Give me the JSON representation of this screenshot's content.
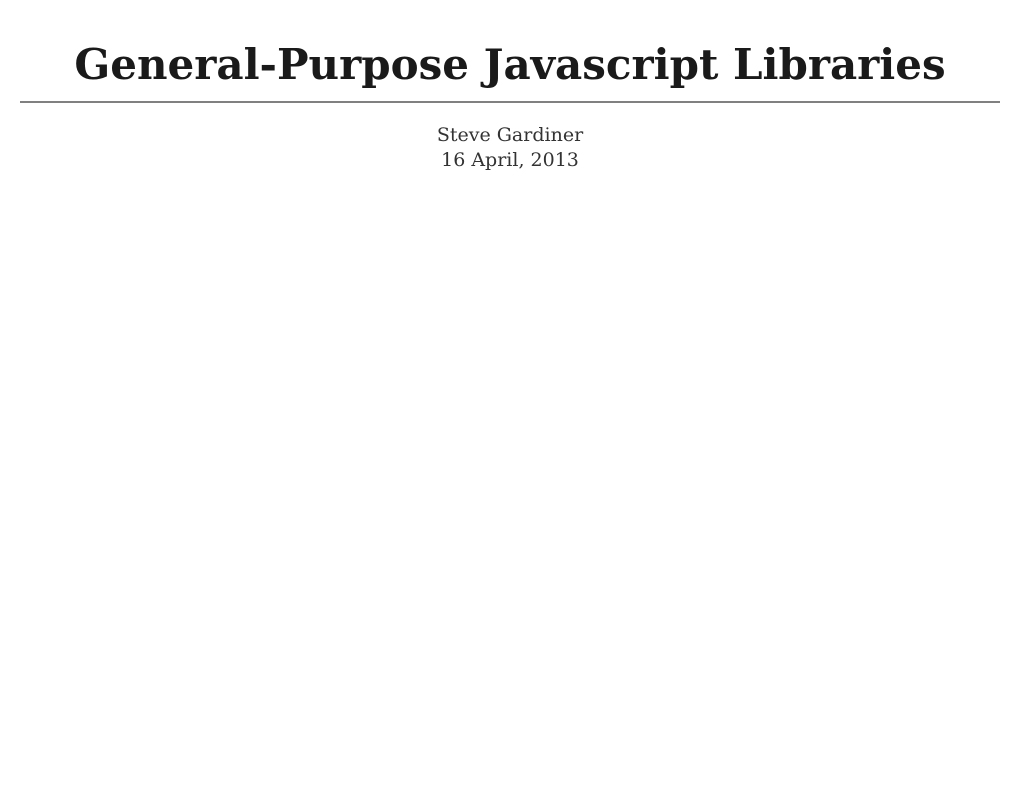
{
  "title": "General-Purpose Javascript Libraries",
  "author": "Steve Gardiner",
  "date": "16 April, 2013"
}
